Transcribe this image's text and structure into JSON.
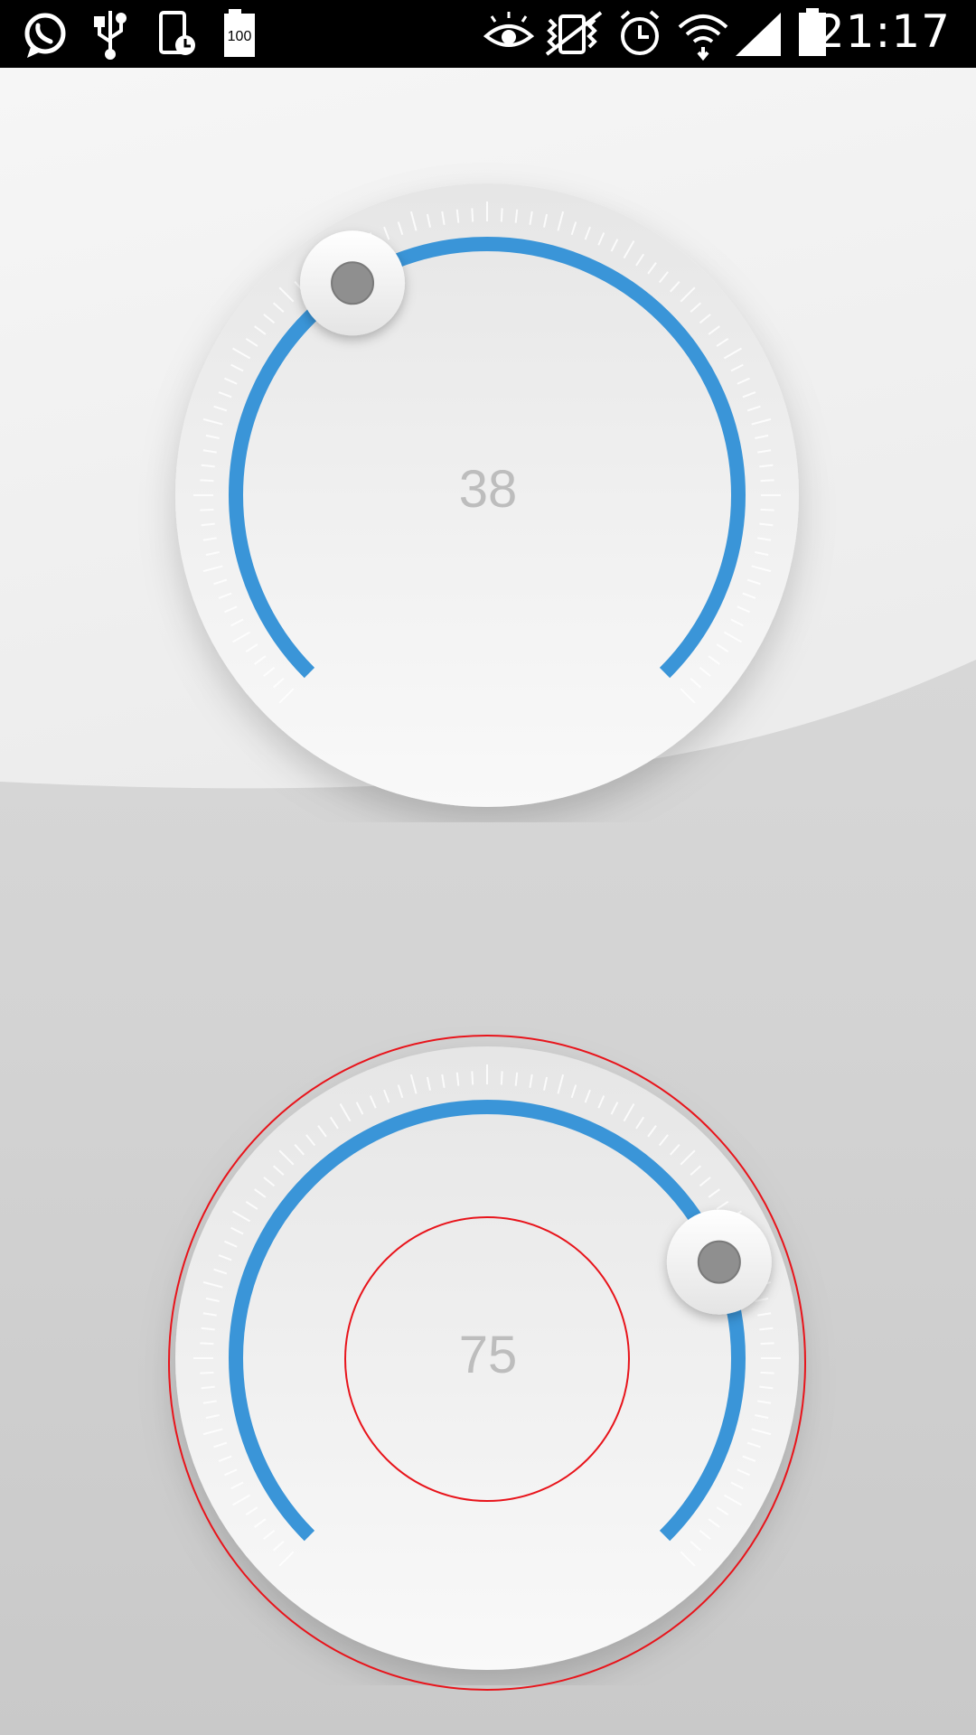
{
  "status_bar": {
    "time": "21:17",
    "battery_level_label": "100",
    "left_icons": [
      "whatsapp-icon",
      "usb-icon",
      "screen-timer-icon",
      "battery-100-icon"
    ],
    "right_icons": [
      "eye-icon",
      "vibrate-icon",
      "alarm-icon",
      "wifi-icon",
      "signal-icon",
      "battery-icon"
    ]
  },
  "dials": [
    {
      "value": "38",
      "fraction": 0.38
    },
    {
      "value": "75",
      "fraction": 0.75,
      "highlighted": true
    }
  ],
  "colors": {
    "arc": "#3a95d8",
    "knob_dot": "#8f8f8f",
    "value_text": "#bdbdbd",
    "highlight_ring": "#e8141b"
  }
}
